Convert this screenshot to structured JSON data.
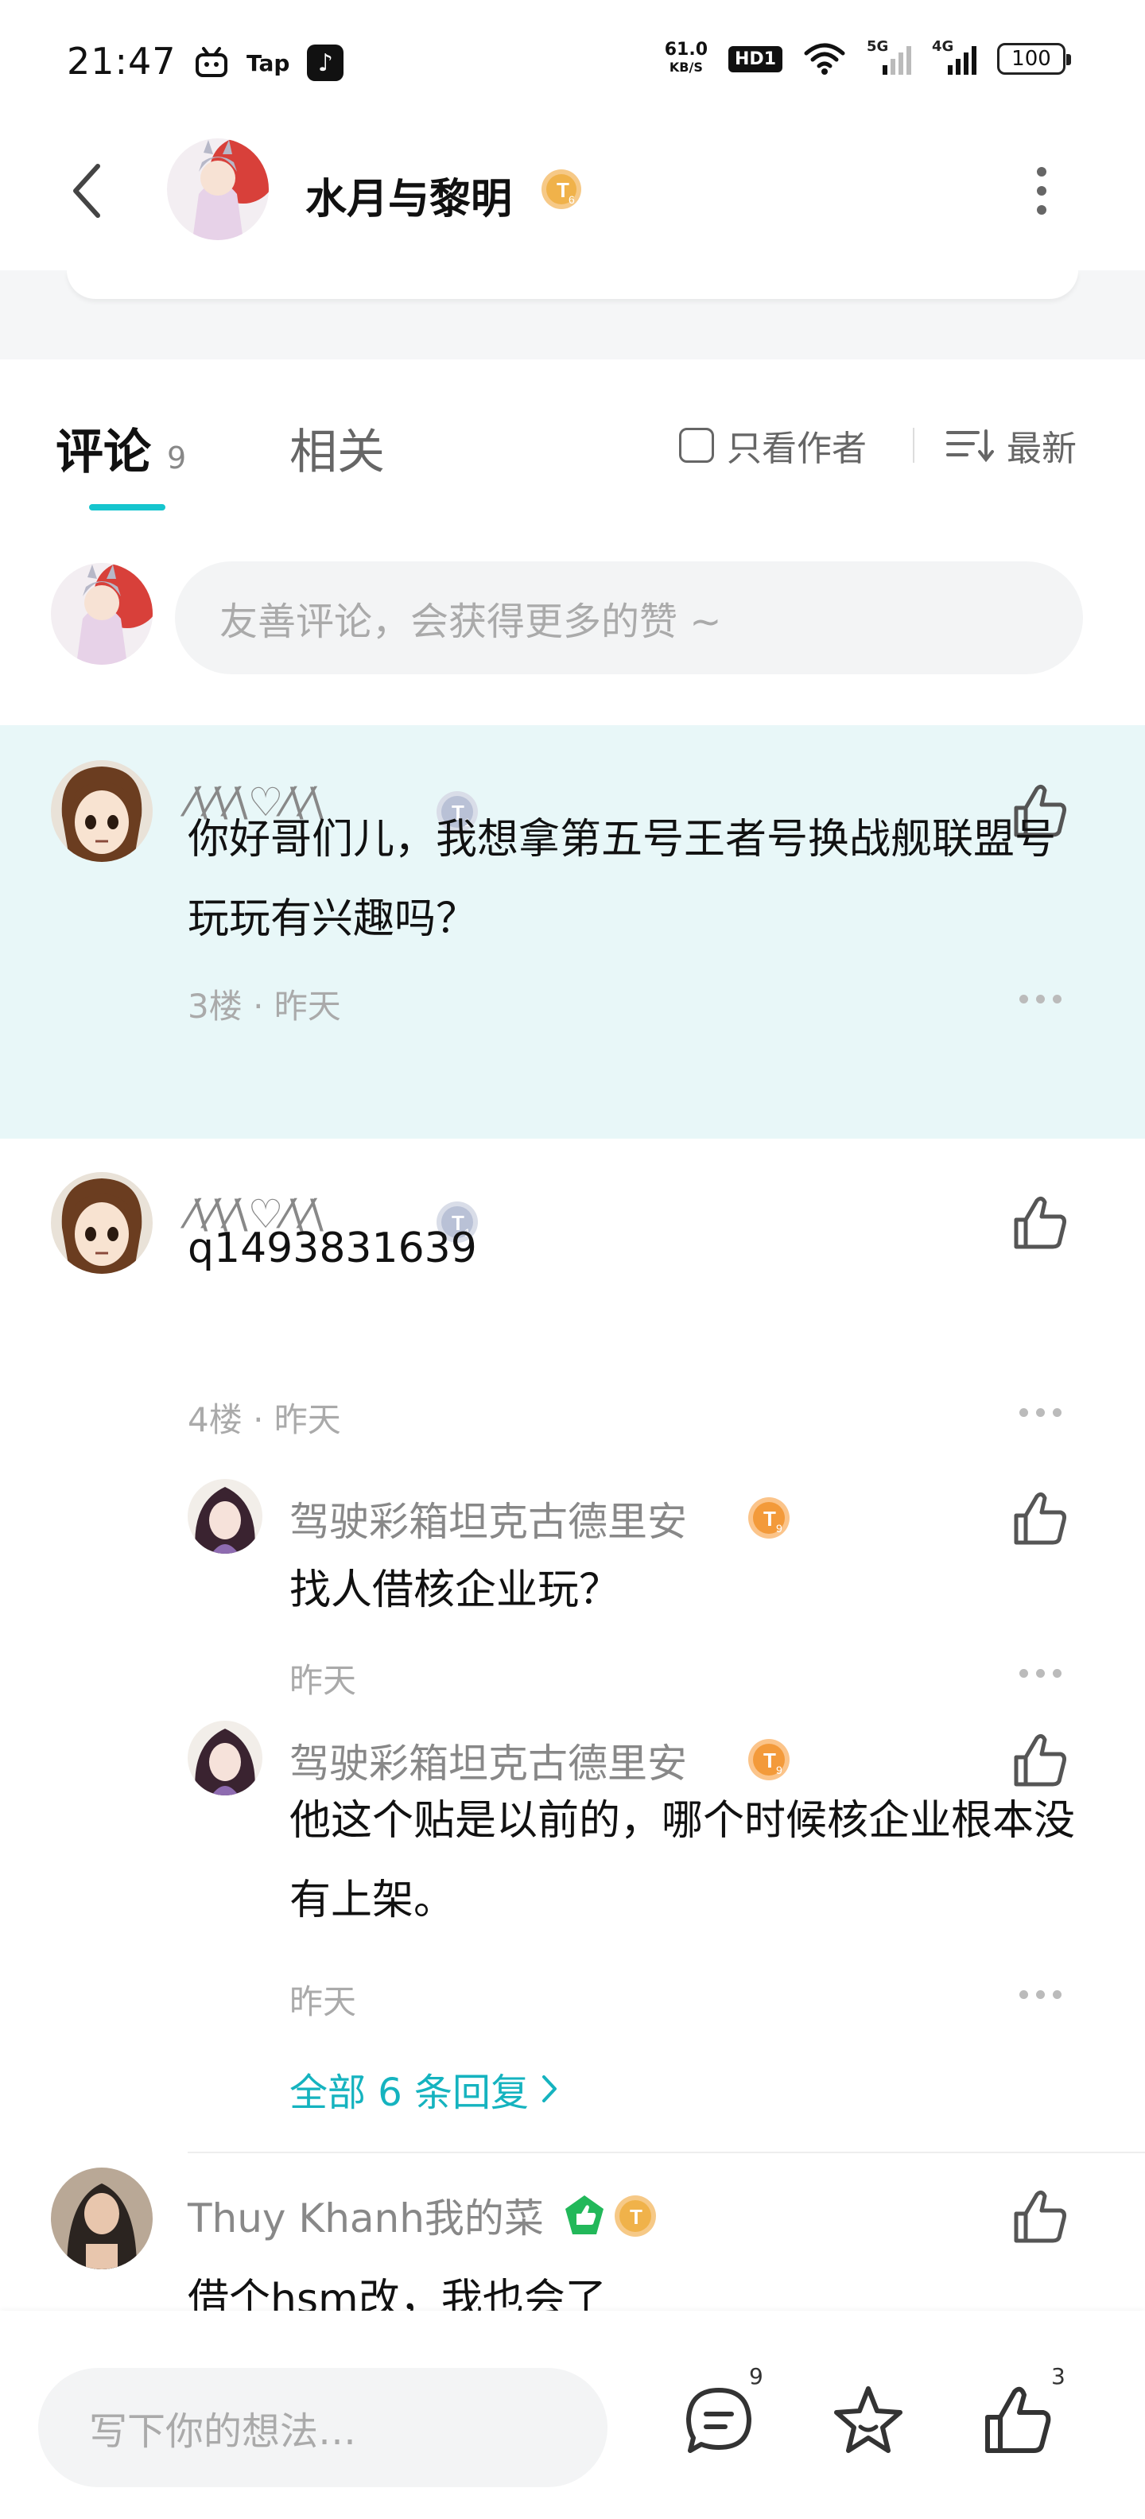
{
  "status_bar": {
    "time": "21:47",
    "apps": [
      "Tap"
    ],
    "net_speed_value": "61.0",
    "net_speed_unit": "KB/S",
    "hd_label": "HD1",
    "signal_5g": "5G",
    "signal_4g": "4G",
    "battery": "100"
  },
  "header": {
    "title": "水月与黎明",
    "level_badge": "T6"
  },
  "tabs": {
    "comments_label": "评论",
    "comments_count": "9",
    "related_label": "相关",
    "author_only_label": "只看作者",
    "sort_label": "最新"
  },
  "compose": {
    "placeholder": "友善评论，会获得更多的赞 ~"
  },
  "comments": [
    {
      "user": "⁄\\⁄\\⁄\\♡⁄\\⁄\\",
      "level": "T1",
      "text": "你好哥们儿，我想拿第五号王者号换战舰联盟号玩玩有兴趣吗？",
      "floor": "3楼 · 昨天"
    },
    {
      "user": "⁄\\⁄\\⁄\\♡⁄\\⁄\\",
      "level": "T1",
      "text": "q1493831639",
      "floor": "4楼 · 昨天",
      "replies": [
        {
          "user": "驾驶彩箱坦克古德里安",
          "level": "T9",
          "text": "找人借核企业玩？",
          "time": "昨天"
        },
        {
          "user": "驾驶彩箱坦克古德里安",
          "level": "T9",
          "text": "他这个贴是以前的，哪个时候核企业根本没有上架。",
          "time": "昨天"
        }
      ],
      "all_replies_label": "全部 6 条回复"
    },
    {
      "user": "Thuy Khanh我的菜",
      "level": "T6",
      "text": "借个hsm改，我也会了"
    }
  ],
  "bottom_bar": {
    "input_placeholder": "写下你的想法…",
    "comment_count": "9",
    "like_count": "3"
  },
  "colors": {
    "accent": "#15c5ce",
    "highlight_bg": "#e8f7f8",
    "level_gold": "#f0b24a",
    "level_orange": "#f39a3a",
    "level_silver": "#b9c1d6"
  }
}
